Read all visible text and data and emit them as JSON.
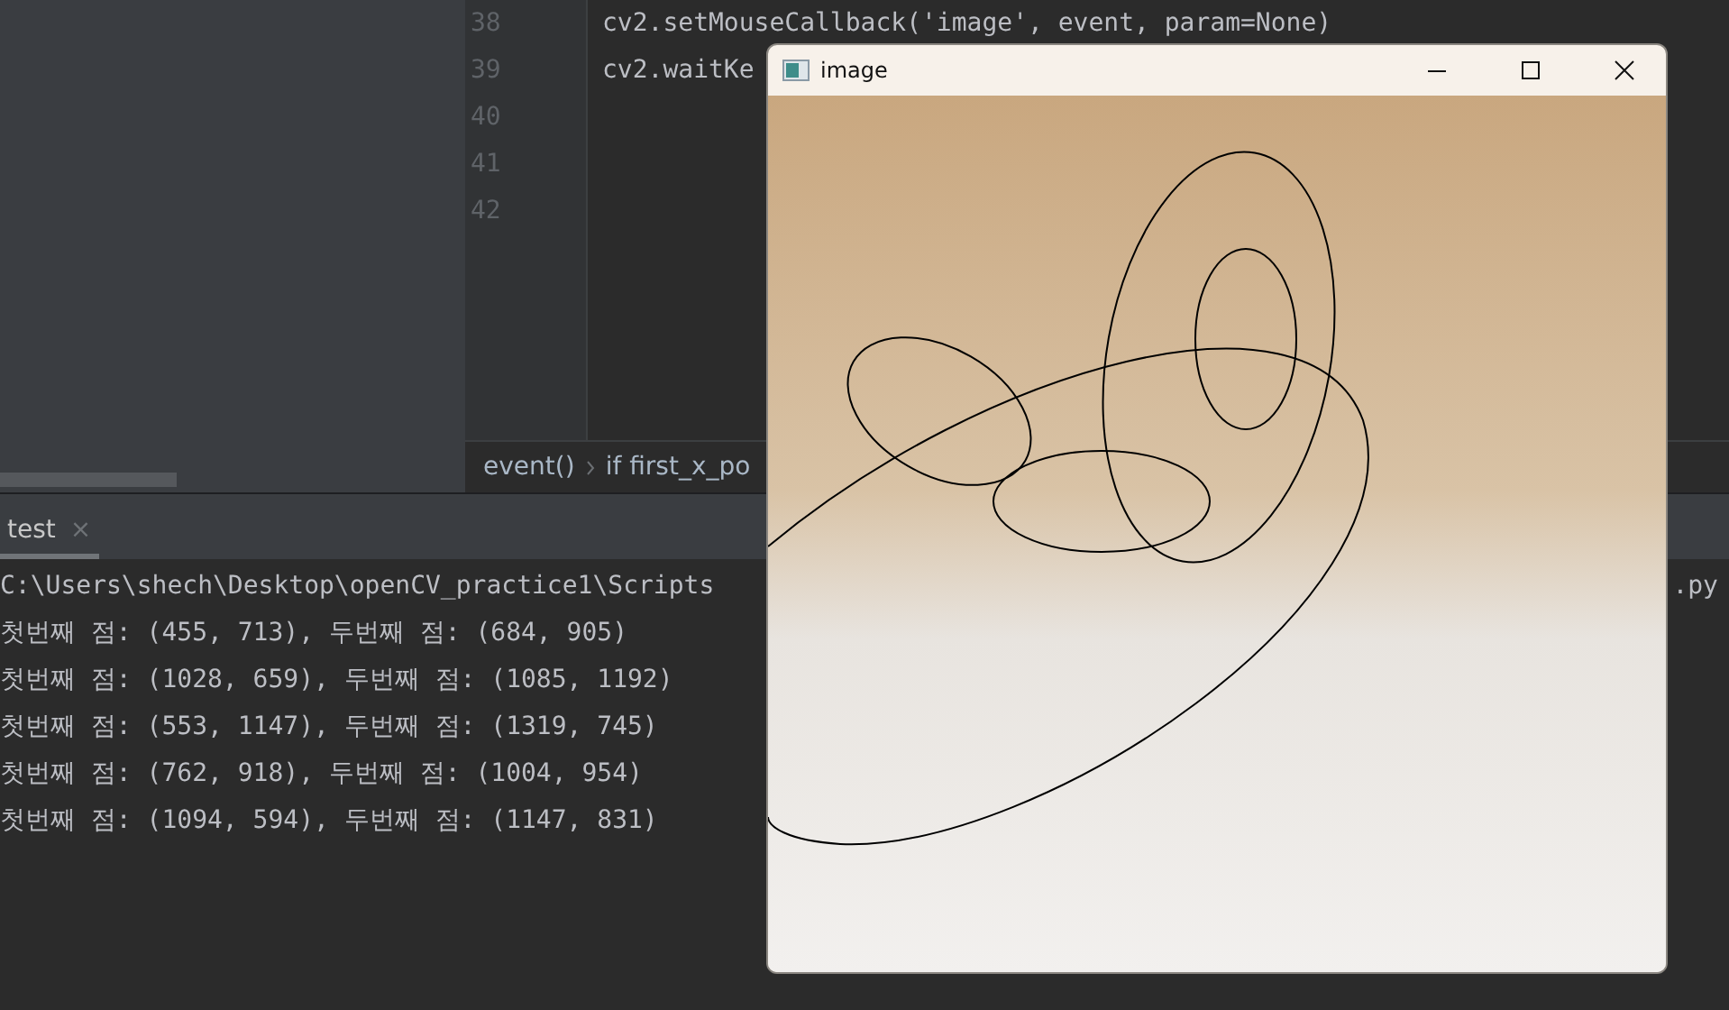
{
  "editor": {
    "lines": [
      {
        "number": "38",
        "code": "cv2.setMouseCallback('image', event, param=None)"
      },
      {
        "number": "39",
        "code": "cv2.waitKe"
      },
      {
        "number": "40"
      },
      {
        "number": "41"
      },
      {
        "number": "42"
      }
    ],
    "breadcrumbs": [
      "event()",
      "if first_x_po"
    ]
  },
  "run_panel": {
    "tab": {
      "label": "test",
      "close": "×",
      "selected": true
    },
    "console": [
      "C:\\Users\\shech\\Desktop\\openCV_practice1\\Scripts",
      "첫번째 점: (455, 713), 두번째 점: (684, 905)",
      "첫번째 점: (1028, 659), 두번째 점: (1085, 1192)",
      "첫번째 점: (553, 1147), 두번째 점: (1319, 745)",
      "첫번째 점: (762, 918), 두번째 점: (1004, 954)",
      "첫번째 점: (1094, 594), 두번째 점: (1147, 831)"
    ],
    "console_tail": ".py"
  },
  "image_window": {
    "title": "image"
  }
}
